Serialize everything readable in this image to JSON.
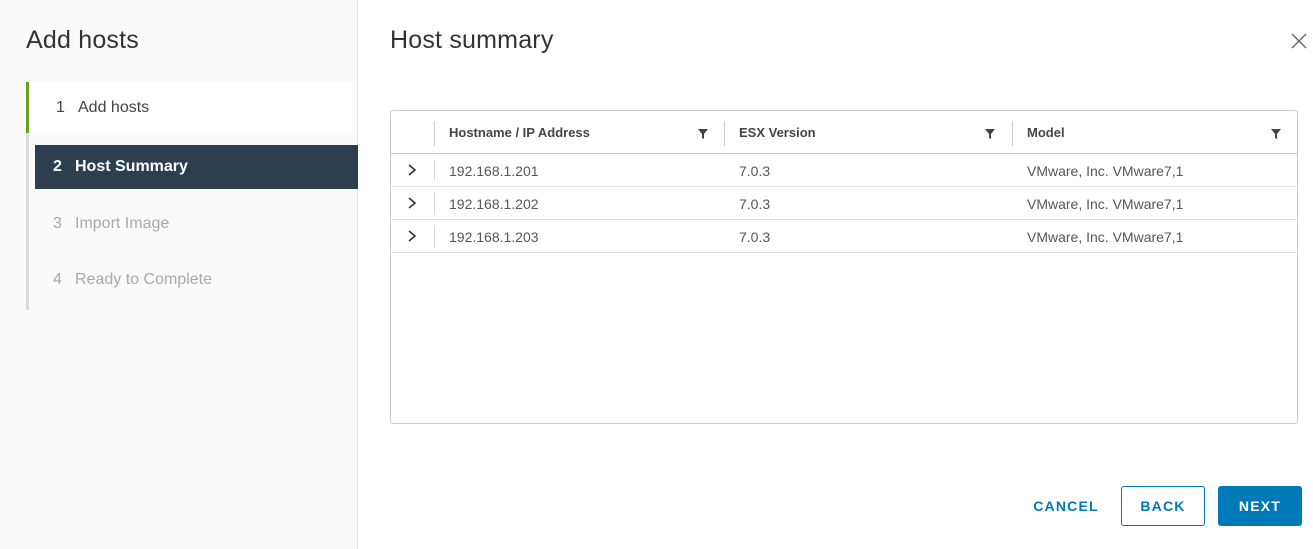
{
  "sidebar": {
    "title": "Add hosts",
    "steps": [
      {
        "num": "1",
        "label": "Add hosts"
      },
      {
        "num": "2",
        "label": "Host Summary"
      },
      {
        "num": "3",
        "label": "Import Image"
      },
      {
        "num": "4",
        "label": "Ready to Complete"
      }
    ]
  },
  "main": {
    "title": "Host summary",
    "close_icon": "close-icon"
  },
  "table": {
    "columns": [
      "Hostname / IP Address",
      "ESX Version",
      "Model"
    ],
    "rows": [
      {
        "host": "192.168.1.201",
        "version": "7.0.3",
        "model": "VMware, Inc. VMware7,1"
      },
      {
        "host": "192.168.1.202",
        "version": "7.0.3",
        "model": "VMware, Inc. VMware7,1"
      },
      {
        "host": "192.168.1.203",
        "version": "7.0.3",
        "model": "VMware, Inc. VMware7,1"
      }
    ]
  },
  "footer": {
    "cancel_label": "CANCEL",
    "back_label": "BACK",
    "next_label": "NEXT"
  },
  "colors": {
    "accent": "#0079b8",
    "active_step_bg": "#2d3e4e",
    "completed_step_marker": "#62a420"
  }
}
